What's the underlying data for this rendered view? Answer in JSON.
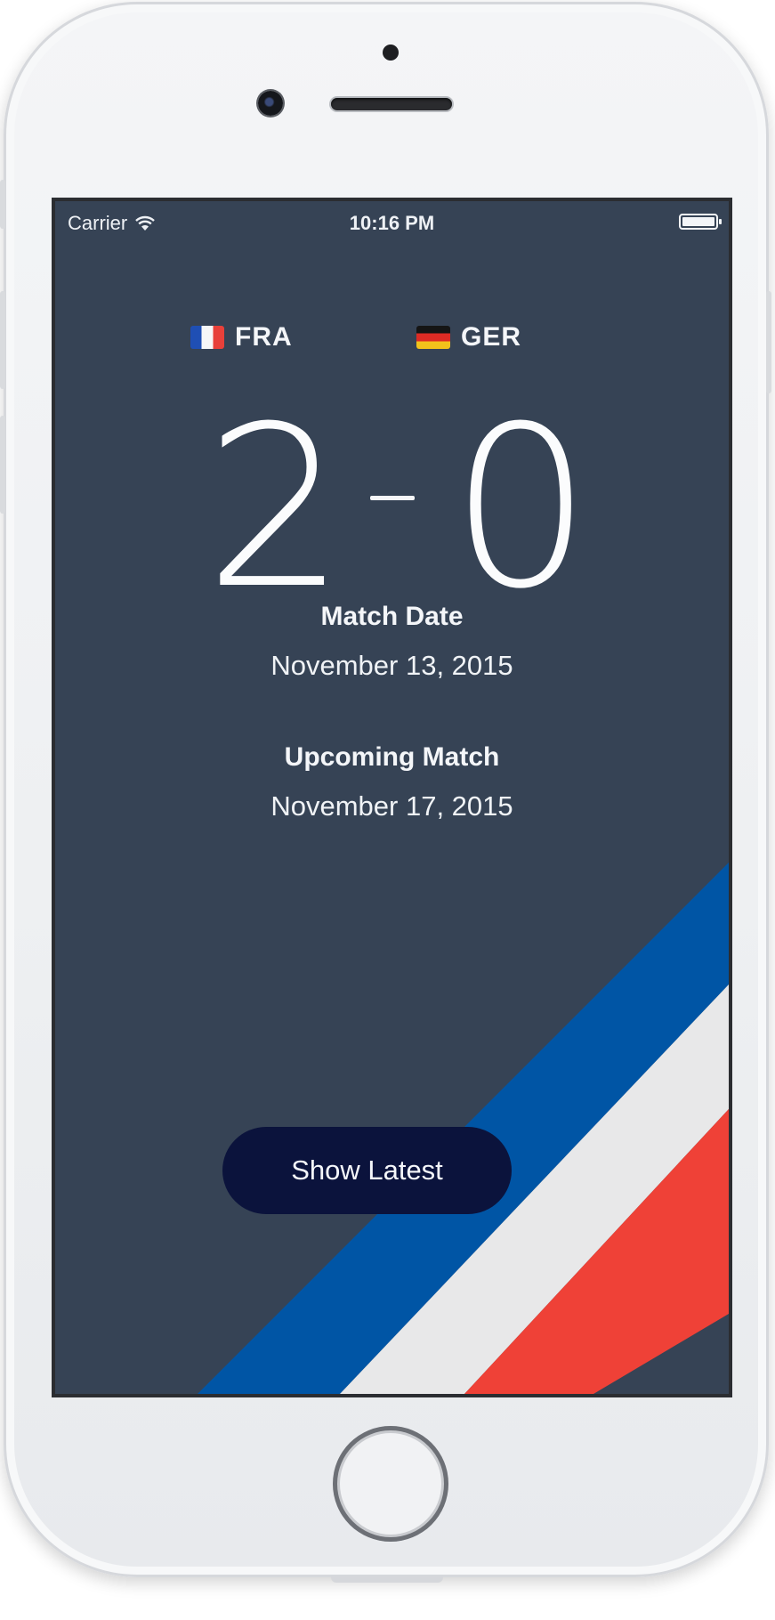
{
  "status_bar": {
    "carrier": "Carrier",
    "wifi_icon": "wifi-icon",
    "time": "10:16 PM",
    "battery_level": 1.0
  },
  "teams": {
    "home": {
      "code": "FRA",
      "flag_icon": "flag-france-icon"
    },
    "away": {
      "code": "GER",
      "flag_icon": "flag-germany-icon"
    }
  },
  "score": {
    "home": "2",
    "away": "0"
  },
  "match_date": {
    "label": "Match Date",
    "value": "November 13, 2015"
  },
  "upcoming_match": {
    "label": "Upcoming Match",
    "value": "November 17, 2015"
  },
  "show_latest_button": {
    "label": "Show Latest"
  },
  "colors": {
    "background": "#364355",
    "stripe_blue": "#0055a5",
    "stripe_white": "#e8e8e9",
    "stripe_red": "#ef4137",
    "button": "#0b133c"
  }
}
